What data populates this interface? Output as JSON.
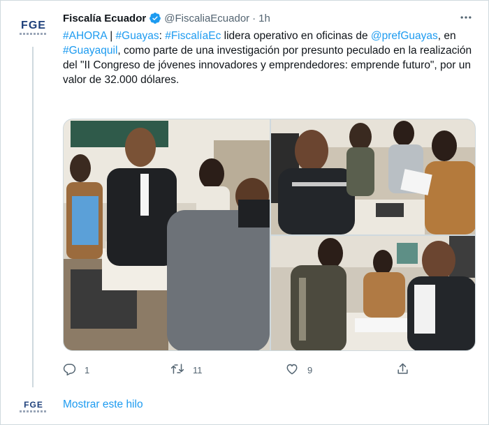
{
  "tweet": {
    "author_name": "Fiscalía Ecuador",
    "handle": "@FiscaliaEcuador",
    "separator": "·",
    "time": "1h",
    "avatar_text": "FGE",
    "text_segments": [
      {
        "text": "#AHORA",
        "link": true
      },
      {
        "text": " | ",
        "link": false
      },
      {
        "text": "#Guayas",
        "link": true
      },
      {
        "text": ": ",
        "link": false
      },
      {
        "text": "#FiscalíaEc",
        "link": true
      },
      {
        "text": " lidera operativo en oficinas de ",
        "link": false
      },
      {
        "text": "@prefGuayas",
        "link": true
      },
      {
        "text": ", en ",
        "link": false
      },
      {
        "text": "#Guayaquil",
        "link": true
      },
      {
        "text": ", como parte de una investigación por presunto peculado en la realización del \"II Congreso de jóvenes innovadores y emprendedores: emprende futuro\", por un valor de 32.000 dólares.",
        "link": false
      }
    ]
  },
  "actions": {
    "reply_count": "1",
    "retweet_count": "11",
    "like_count": "9"
  },
  "thread": {
    "avatar_text": "FGE",
    "show_thread_label": "Mostrar este hilo"
  },
  "icons": {
    "verified": "verified-badge-icon",
    "more": "more-horizontal-icon",
    "reply": "reply-icon",
    "retweet": "retweet-icon",
    "like": "heart-icon",
    "share": "share-icon"
  },
  "colors": {
    "link": "#1d9bf0",
    "text": "#0f1419",
    "secondary": "#536471",
    "border": "#cfd9de",
    "brand_logo": "#1d3f7a"
  }
}
